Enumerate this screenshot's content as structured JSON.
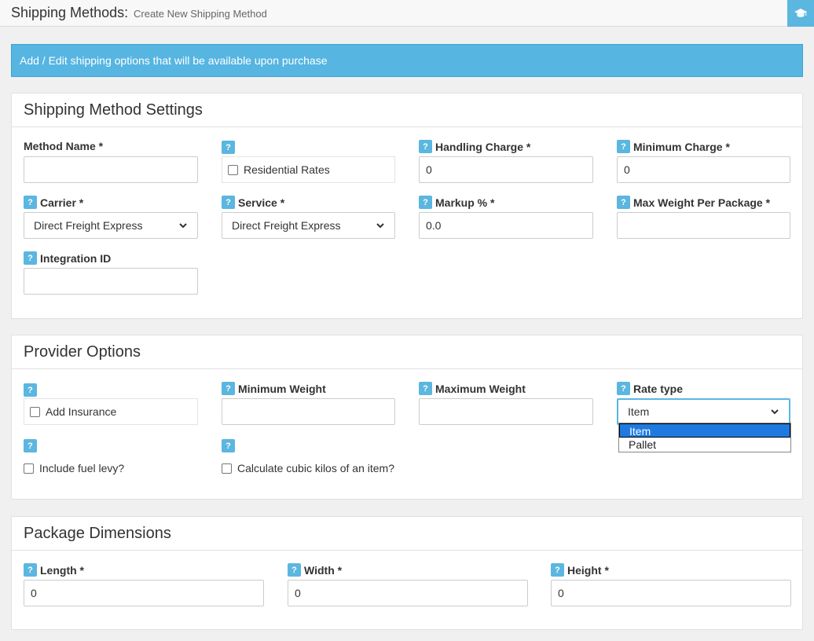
{
  "header": {
    "title": "Shipping Methods:",
    "subtitle": "Create New Shipping Method",
    "help_icon": "graduation-cap-icon"
  },
  "info": {
    "text": "Add / Edit shipping options that will be available upon purchase"
  },
  "settings": {
    "title": "Shipping Method Settings",
    "method_name": {
      "label": "Method Name *",
      "value": ""
    },
    "residential": {
      "label": "Residential Rates",
      "checked": false
    },
    "handling": {
      "label": "Handling Charge *",
      "value": "0"
    },
    "min_charge": {
      "label": "Minimum Charge *",
      "value": "0"
    },
    "carrier": {
      "label": "Carrier *",
      "value": "Direct Freight Express"
    },
    "service": {
      "label": "Service *",
      "value": "Direct Freight Express"
    },
    "markup": {
      "label": "Markup % *",
      "value": "0.0"
    },
    "max_weight": {
      "label": "Max Weight Per Package *",
      "value": ""
    },
    "integration": {
      "label": "Integration ID",
      "value": ""
    }
  },
  "provider": {
    "title": "Provider Options",
    "insurance": {
      "label": "Add Insurance",
      "checked": false
    },
    "min_weight": {
      "label": "Minimum Weight",
      "value": ""
    },
    "max_weight": {
      "label": "Maximum Weight",
      "value": ""
    },
    "rate_type": {
      "label": "Rate type",
      "value": "Item",
      "options": [
        "Item",
        "Pallet"
      ],
      "highlighted": "Item"
    },
    "fuel_levy": {
      "label": "Include fuel levy?",
      "checked": false
    },
    "cubic": {
      "label": "Calculate cubic kilos of an item?",
      "checked": false
    }
  },
  "dimensions": {
    "title": "Package Dimensions",
    "length": {
      "label": "Length *",
      "value": "0"
    },
    "width": {
      "label": "Width *",
      "value": "0"
    },
    "height": {
      "label": "Height *",
      "value": "0"
    }
  },
  "help_badge": "?",
  "colors": {
    "accent": "#5bb6e0",
    "info_bg": "#56b5e1",
    "highlight": "#1e7ae0"
  }
}
